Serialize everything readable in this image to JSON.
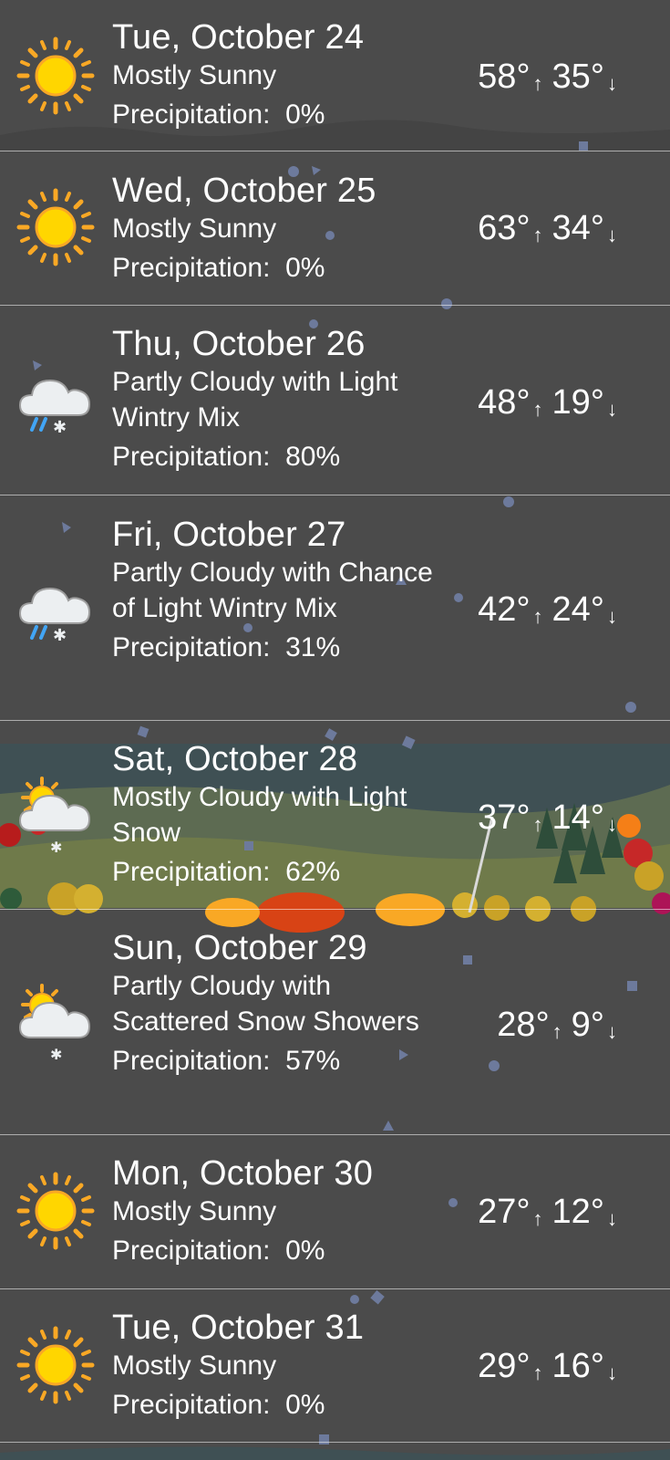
{
  "forecast": [
    {
      "day": "Tue, October 24",
      "condition": "Mostly Sunny",
      "precip_label": "Precipitation:",
      "precip_value": "0%",
      "high": "58°",
      "low": "35°",
      "icon": "sun-icon"
    },
    {
      "day": "Wed, October 25",
      "condition": "Mostly Sunny",
      "precip_label": "Precipitation:",
      "precip_value": "0%",
      "high": "63°",
      "low": "34°",
      "icon": "sun-icon"
    },
    {
      "day": "Thu, October 26",
      "condition": "Partly Cloudy with Light Wintry Mix",
      "precip_label": "Precipitation:",
      "precip_value": "80%",
      "high": "48°",
      "low": "19°",
      "icon": "cloud-wintry-mix-icon"
    },
    {
      "day": "Fri, October 27",
      "condition": "Partly Cloudy with Chance of Light Wintry Mix",
      "precip_label": "Precipitation:",
      "precip_value": "31%",
      "high": "42°",
      "low": "24°",
      "icon": "cloud-wintry-mix-icon"
    },
    {
      "day": "Sat, October 28",
      "condition": "Mostly Cloudy with Light Snow",
      "precip_label": "Precipitation:",
      "precip_value": "62%",
      "high": "37°",
      "low": "14°",
      "icon": "sun-cloud-snow-icon"
    },
    {
      "day": "Sun, October 29",
      "condition": "Partly Cloudy with Scattered Snow Showers",
      "precip_label": "Precipitation:",
      "precip_value": "57%",
      "high": "28°",
      "low": "9°",
      "icon": "sun-cloud-snow-icon"
    },
    {
      "day": "Mon, October 30",
      "condition": "Mostly Sunny",
      "precip_label": "Precipitation:",
      "precip_value": "0%",
      "high": "27°",
      "low": "12°",
      "icon": "sun-icon"
    },
    {
      "day": "Tue, October 31",
      "condition": "Mostly Sunny",
      "precip_label": "Precipitation:",
      "precip_value": "0%",
      "high": "29°",
      "low": "16°",
      "icon": "sun-icon"
    }
  ],
  "arrows": {
    "up": "↑",
    "down": "↓"
  },
  "colors": {
    "background": "#4b4b4b",
    "sun": "#ffd600",
    "sun_ray": "#f9a825",
    "cloud": "#eceff1",
    "rain": "#42a5f5"
  }
}
